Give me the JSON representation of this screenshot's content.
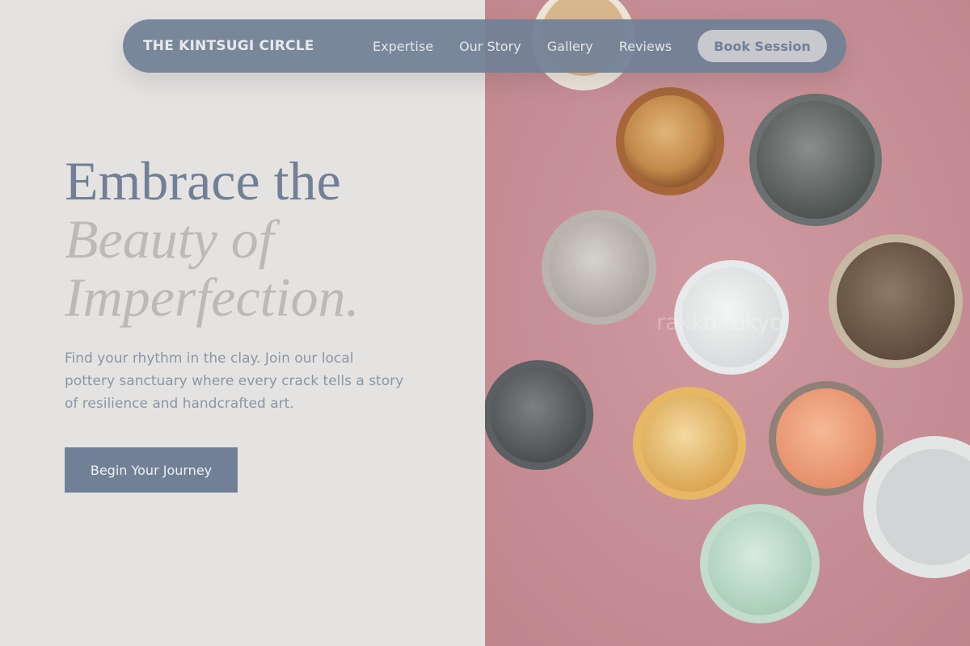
{
  "nav": {
    "brand": "THE KINTSUGI CIRCLE",
    "links": [
      "Expertise",
      "Our Story",
      "Gallery",
      "Reviews"
    ],
    "cta_label": "Book Session"
  },
  "hero": {
    "headline_line1": "Embrace the",
    "headline_line2": "Beauty of",
    "headline_line3": "Imperfection.",
    "subtitle": "Find your rhythm in the clay. Join our local pottery sanctuary where every crack tells a story of resilience and handcrafted art.",
    "cta_label": "Begin Your Journey"
  },
  "photo": {
    "watermark": "rakko.tokyo"
  },
  "colors": {
    "accent": "#718096",
    "page_background": "#e5e3e2",
    "photo_background": "#c98f95",
    "headline_muted": "#bcbab8"
  }
}
